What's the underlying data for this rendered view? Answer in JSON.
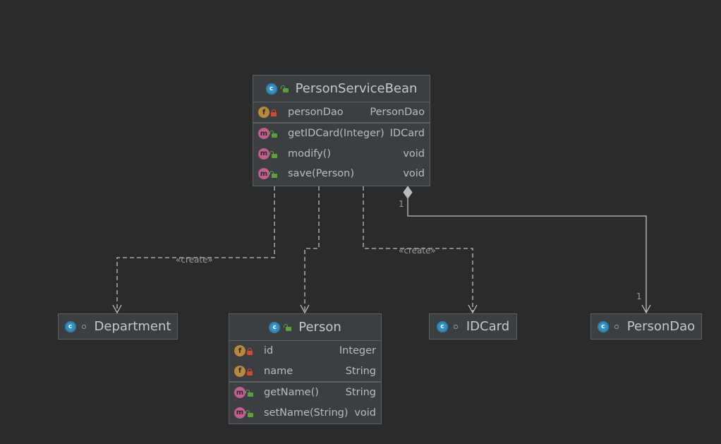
{
  "classes": {
    "psb": {
      "name": "PersonServiceBean",
      "fields": [
        {
          "name": "personDao",
          "type": "PersonDao"
        }
      ],
      "methods": [
        {
          "name": "getIDCard(Integer)",
          "type": "IDCard"
        },
        {
          "name": "modify()",
          "type": "void"
        },
        {
          "name": "save(Person)",
          "type": "void"
        }
      ]
    },
    "department": {
      "name": "Department"
    },
    "person": {
      "name": "Person",
      "fields": [
        {
          "name": "id",
          "type": "Integer"
        },
        {
          "name": "name",
          "type": "String"
        }
      ],
      "methods": [
        {
          "name": "getName()",
          "type": "String"
        },
        {
          "name": "setName(String)",
          "type": "void"
        }
      ]
    },
    "idcard": {
      "name": "IDCard"
    },
    "persondao": {
      "name": "PersonDao"
    }
  },
  "relations": {
    "create_label_1": "«create»",
    "create_label_2": "«create»",
    "mult_source": "1",
    "mult_target": "1"
  },
  "icons": {
    "class_letter": "c",
    "field_letter": "f",
    "method_letter": "m"
  },
  "colors": {
    "background": "#2b2b2b",
    "box": "#3c3f41",
    "border": "#5e6060",
    "class_icon": "#3592c4",
    "field_icon": "#b8893c",
    "method_icon": "#c25f8e"
  }
}
